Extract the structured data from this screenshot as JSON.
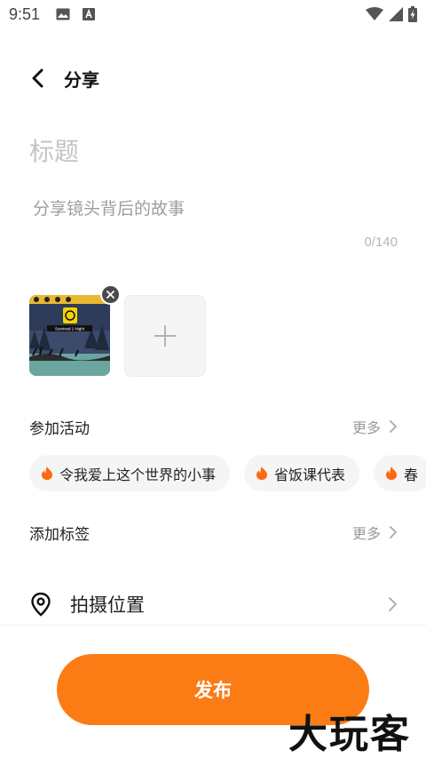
{
  "status_bar": {
    "time": "9:51",
    "left_icons": [
      "image-icon",
      "a-badge-icon"
    ],
    "right_icons": [
      "wifi-icon",
      "signal-icon",
      "battery-charging-icon"
    ]
  },
  "header": {
    "title": "分享"
  },
  "form": {
    "title_placeholder": "标题",
    "story_placeholder": "分享镜头背后的故事",
    "char_count": "0/140"
  },
  "photos": {
    "thumbnail_caption": "Survived 1 Night"
  },
  "activities": {
    "title": "参加活动",
    "more_label": "更多",
    "chips": [
      {
        "label": "令我爱上这个世界的小事"
      },
      {
        "label": "省饭课代表"
      },
      {
        "label": "春"
      }
    ]
  },
  "tags": {
    "title": "添加标签",
    "more_label": "更多"
  },
  "location": {
    "label": "拍摄位置"
  },
  "publish": {
    "label": "发布"
  },
  "watermark": {
    "text": "大玩客"
  },
  "colors": {
    "accent": "#fb7c14",
    "chip_bg": "#f5f5f5",
    "placeholder": "#c4c4c4"
  }
}
